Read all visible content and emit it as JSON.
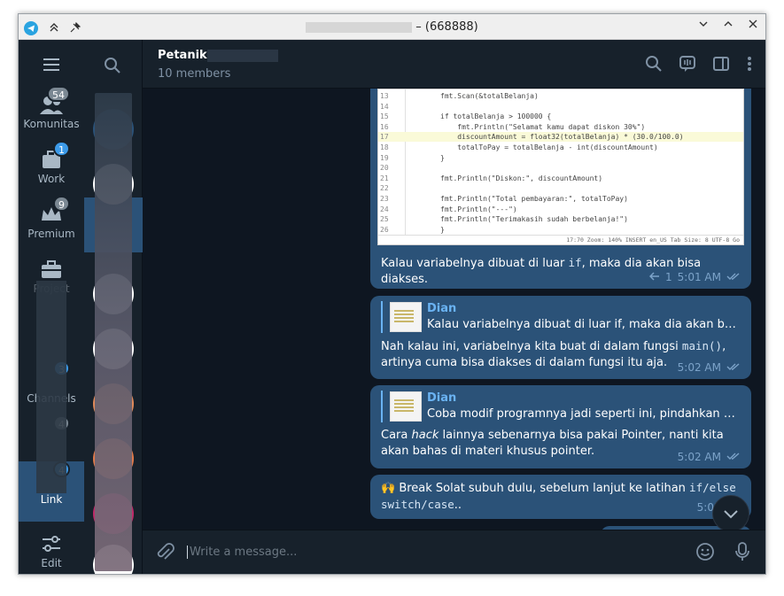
{
  "window": {
    "title_suffix": "– (668888)"
  },
  "folders": [
    {
      "id": "menu",
      "label": "",
      "badge": ""
    },
    {
      "id": "komunitas",
      "label": "Komunitas",
      "badge": "54"
    },
    {
      "id": "work",
      "label": "Work",
      "badge": "1"
    },
    {
      "id": "premium",
      "label": "Premium",
      "badge": "9"
    },
    {
      "id": "project",
      "label": "Project",
      "badge": ""
    },
    {
      "id": "channels",
      "label": "Channels",
      "badge": "3"
    },
    {
      "id": "unknown",
      "label": "",
      "badge": "4"
    },
    {
      "id": "linkedin",
      "label": "Link",
      "badge": "4"
    },
    {
      "id": "edit",
      "label": "Edit",
      "badge": ""
    }
  ],
  "chat": {
    "title": "Petanik",
    "members": "10 members",
    "placeholder": "Write a message..."
  },
  "code_image": {
    "lines": [
      {
        "n": "13",
        "t": "fmt.Scan(&totalBelanja)"
      },
      {
        "n": "14",
        "t": ""
      },
      {
        "n": "15",
        "t": "if totalBelanja > 100000 {"
      },
      {
        "n": "16",
        "t": "    fmt.Println(\"Selamat kamu dapat diskon 30%\")"
      },
      {
        "n": "17",
        "t": "    discountAmount = float32(totalBelanja) * (30.0/100.0)"
      },
      {
        "n": "18",
        "t": "    totalToPay = totalBelanja - int(discountAmount)"
      },
      {
        "n": "19",
        "t": "}"
      },
      {
        "n": "20",
        "t": ""
      },
      {
        "n": "21",
        "t": "fmt.Println(\"Diskon:\", discountAmount)"
      },
      {
        "n": "22",
        "t": ""
      },
      {
        "n": "23",
        "t": "fmt.Println(\"Total pembayaran:\", totalToPay)"
      },
      {
        "n": "24",
        "t": "fmt.Println(\"---\")"
      },
      {
        "n": "25",
        "t": "fmt.Println(\"Terimakasih sudah berbelanja!\")"
      },
      {
        "n": "26",
        "t": "}"
      }
    ],
    "status": "17:70   Zoom: 140%   INSERT   en_US   Tab Size: 8   UTF-8   Go"
  },
  "messages": [
    {
      "id": "m1",
      "text": "Kalau variabelnya dibuat di luar if, maka dia akan bisa diakses.",
      "replies": "1",
      "time": "5:01 AM"
    },
    {
      "id": "m2",
      "reply_name": "Dian",
      "reply_text": "Kalau variabelnya dibuat di luar if, maka dia akan bisa di...",
      "text_a": "Nah kalau ini, variabelnya kita buat di dalam fungsi ",
      "code": "main()",
      "text_b": ", artinya cuma bisa diakses di dalam fungsi itu aja.",
      "time": "5:02 AM"
    },
    {
      "id": "m3",
      "reply_name": "Dian",
      "reply_text": "Coba modif programnya jadi seperti ini, pindahkan pri...",
      "text_a": "Cara ",
      "em": "hack",
      "text_b": " lainnya sebenarnya bisa pakai Pointer, nanti kita akan bahas di materi khusus pointer.",
      "time": "5:02 AM"
    },
    {
      "id": "m4",
      "emoji": "🙌",
      "text_a": " Break Solat subuh dulu, sebelum lanjut ke latihan ",
      "code_a": "if/else",
      "text_b": " ",
      "code_b": "switch/case",
      "text_c": "..",
      "time": "5:03 AM"
    }
  ],
  "colors": {
    "bubble": "#2b5278",
    "bg": "#0e1621",
    "panel": "#17212b",
    "accent": "#6ab3f3"
  }
}
